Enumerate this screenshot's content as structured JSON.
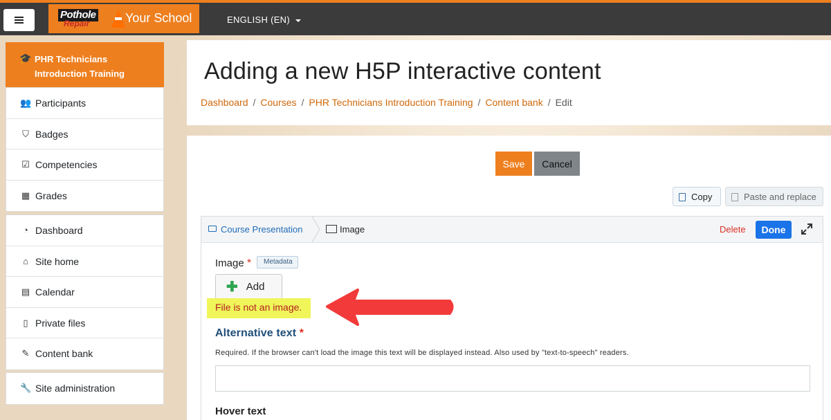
{
  "navbar": {
    "menu_icon": "hamburger-icon",
    "logo_line1": "Pothole",
    "logo_line2": "Repair",
    "brand_name": "Your School",
    "language": "ENGLISH (EN)"
  },
  "sidebar": {
    "course_title": "PHR Technicians Introduction Training",
    "course_icon": "graduation-cap-icon",
    "group1": [
      {
        "label": "Participants",
        "icon": "users-icon",
        "glyph": "👥"
      },
      {
        "label": "Badges",
        "icon": "shield-icon",
        "glyph": "⛉"
      },
      {
        "label": "Competencies",
        "icon": "checkbox-icon",
        "glyph": "☑"
      },
      {
        "label": "Grades",
        "icon": "table-icon",
        "glyph": "▦"
      }
    ],
    "group2": [
      {
        "label": "Dashboard",
        "icon": "dashboard-icon",
        "glyph": "◔"
      },
      {
        "label": "Site home",
        "icon": "home-icon",
        "glyph": "⌂"
      },
      {
        "label": "Calendar",
        "icon": "calendar-icon",
        "glyph": "▤"
      },
      {
        "label": "Private files",
        "icon": "file-icon",
        "glyph": "▯"
      },
      {
        "label": "Content bank",
        "icon": "brush-icon",
        "glyph": "✎"
      }
    ],
    "group3": [
      {
        "label": "Site administration",
        "icon": "wrench-icon",
        "glyph": "🔧"
      }
    ]
  },
  "header": {
    "title": "Adding a new H5P interactive content",
    "breadcrumb": [
      "Dashboard",
      "Courses",
      "PHR Technicians Introduction Training",
      "Content bank"
    ],
    "breadcrumb_current": "Edit"
  },
  "actions": {
    "save": "Save",
    "cancel": "Cancel",
    "copy": "Copy",
    "paste": "Paste and replace"
  },
  "editor": {
    "crumb_parent": "Course Presentation",
    "crumb_current": "Image",
    "delete": "Delete",
    "done": "Done",
    "image_label": "Image",
    "required_mark": "*",
    "metadata": "Metadata",
    "add_button": "Add",
    "error": "File is not an image.",
    "alt_label": "Alternative text",
    "alt_description": "Required. If the browser can't load the image this text will be displayed instead. Also used by \"text-to-speech\" readers.",
    "alt_value": "",
    "hover_label": "Hover text"
  },
  "colors": {
    "accent": "#ee7f1f",
    "error": "#d93025",
    "done": "#1a73e8",
    "highlight": "#f0f55a",
    "arrow": "#f23a3a"
  }
}
